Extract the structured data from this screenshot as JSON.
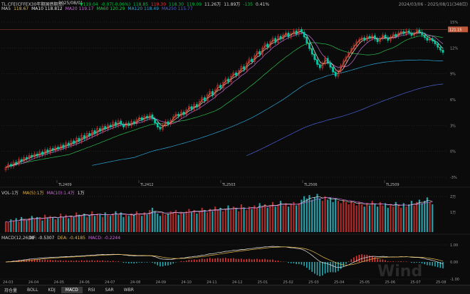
{
  "top_bar": {
    "title": "TL.CFE(CFFEX30年期国债期货)",
    "date": "2025/08/01",
    "items": [
      {
        "text": "▼119.04",
        "color": "#00c040"
      },
      {
        "text": "-0.07(-0.06%)",
        "color": "#00c040"
      },
      {
        "text": "118.85",
        "color": "#00c040"
      },
      {
        "text": "119.30",
        "color": "#e83a3a"
      },
      {
        "text": "118.30",
        "color": "#00c040"
      },
      {
        "text": "119.09",
        "color": "#00c040"
      },
      {
        "text": "11.26万",
        "color": "#cfcfcf"
      },
      {
        "text": "11.89万",
        "color": "#cfcfcf"
      },
      {
        "text": "-135",
        "color": "#00c040"
      },
      {
        "text": "0.41%",
        "color": "#cfcfcf"
      }
    ],
    "range": "2024/03/06 - 2025/08/11(348日)"
  },
  "ma_bar": {
    "items": [
      {
        "label": "MA5",
        "value": "",
        "color": "#cfcfcf"
      },
      {
        "label": "118.67",
        "value": "",
        "color": "#e8b84a"
      },
      {
        "label": "MA10",
        "value": "118.812",
        "color": "#e9e9e9"
      },
      {
        "label": "MA20",
        "value": "119.17",
        "color": "#c96ad8"
      },
      {
        "label": "MA60",
        "value": "120.29",
        "color": "#2bbf4d"
      },
      {
        "label": "MA120",
        "value": "118.49",
        "color": "#2aa6d6"
      },
      {
        "label": "MA250",
        "value": "115.77",
        "color": "#4a63d8"
      }
    ]
  },
  "chart_data": [
    {
      "type": "candlestick",
      "name": "main",
      "y_pct_ticks": [
        "15%",
        "12%",
        "9%",
        "6%",
        "3%",
        "0%",
        "-3%"
      ],
      "price_tag": "121.15",
      "x_labels": [
        "TL2409",
        "TL2412",
        "TL2503",
        "TL2506",
        "TL2509"
      ],
      "ma_colors": {
        "ma5": "#e8b84a",
        "ma10": "#e9e9e9",
        "ma20": "#c96ad8",
        "ma60": "#2bbf4d",
        "ma120": "#2aa6d6",
        "ma250": "#4a63d8"
      },
      "close": [
        102.3,
        102.8,
        102.5,
        103.1,
        102.9,
        103.5,
        103.2,
        103.8,
        103.6,
        104.1,
        103.9,
        104.3,
        104.0,
        104.6,
        104.2,
        104.9,
        104.5,
        105.1,
        104.8,
        105.3,
        105.0,
        105.6,
        105.2,
        105.9,
        105.5,
        106.2,
        105.8,
        106.6,
        106.1,
        107.0,
        106.5,
        107.3,
        106.9,
        107.7,
        107.2,
        108.0,
        107.6,
        108.3,
        107.9,
        108.5,
        108.2,
        108.9,
        108.4,
        109.1,
        108.6,
        108.2,
        108.8,
        108.4,
        109.0,
        108.7,
        109.3,
        109.6,
        109.2,
        109.8,
        109.5,
        110.0,
        109.4,
        108.8,
        108.2,
        107.9,
        108.5,
        109.0,
        108.6,
        109.2,
        109.7,
        110.1,
        109.8,
        110.4,
        110.0,
        110.7,
        111.2,
        110.8,
        111.5,
        111.1,
        111.9,
        112.5,
        112.0,
        112.9,
        113.4,
        112.8,
        113.6,
        114.3,
        113.9,
        114.7,
        115.2,
        114.8,
        115.6,
        116.1,
        115.7,
        116.4,
        117.0,
        116.6,
        117.5,
        118.1,
        117.7,
        118.6,
        119.2,
        118.8,
        119.7,
        120.3,
        119.8,
        120.6,
        121.1,
        120.5,
        121.4,
        121.0,
        121.6,
        121.9,
        121.3,
        121.8,
        122.2,
        121.7,
        122.4,
        122.0,
        121.3,
        120.4,
        119.6,
        118.8,
        118.0,
        117.3,
        116.8,
        117.5,
        118.2,
        117.6,
        116.9,
        116.2,
        115.6,
        116.4,
        117.1,
        117.8,
        118.4,
        119.0,
        119.6,
        120.1,
        120.6,
        120.9,
        121.2,
        120.8,
        121.4,
        121.1,
        121.5,
        121.0,
        120.6,
        121.1,
        121.6,
        121.2,
        120.8,
        121.3,
        121.7,
        121.4,
        121.9,
        122.1,
        121.8,
        122.2,
        121.9,
        121.5,
        121.8,
        122.3,
        122.0,
        121.6,
        121.2,
        120.8,
        121.1,
        120.7,
        120.3,
        119.8,
        119.4,
        119.04
      ],
      "volume_unit": "VOL",
      "volume": [
        9,
        8,
        11,
        10,
        12,
        9,
        13,
        11,
        10,
        12,
        14,
        11,
        13,
        12,
        10,
        15,
        12,
        14,
        13,
        11,
        12,
        16,
        13,
        15,
        12,
        14,
        13,
        17,
        15,
        14,
        16,
        13,
        15,
        18,
        14,
        16,
        15,
        13,
        17,
        15,
        14,
        16,
        18,
        15,
        17,
        13,
        15,
        14,
        16,
        15,
        18,
        16,
        14,
        17,
        15,
        19,
        21,
        18,
        16,
        14,
        17,
        15,
        16,
        18,
        17,
        19,
        15,
        17,
        16,
        18,
        20,
        17,
        19,
        16,
        18,
        21,
        19,
        17,
        20,
        18,
        22,
        19,
        21,
        18,
        20,
        23,
        19,
        22,
        20,
        18,
        24,
        21,
        19,
        22,
        20,
        23,
        21,
        25,
        22,
        24,
        21,
        23,
        26,
        22,
        24,
        27,
        23,
        25,
        22,
        24,
        26,
        23,
        25,
        28,
        31,
        29,
        32,
        28,
        30,
        33,
        29,
        27,
        31,
        28,
        30,
        26,
        29,
        27,
        25,
        28,
        26,
        24,
        27,
        25,
        23,
        26,
        24,
        22,
        25,
        23,
        27,
        24,
        22,
        26,
        23,
        25,
        21,
        24,
        22,
        26,
        23,
        21,
        25,
        22,
        24,
        27,
        23,
        26,
        28,
        25,
        27,
        30,
        26,
        24
      ]
    },
    {
      "type": "volume",
      "name": "vol",
      "label": "VOL-1万",
      "ma_labels": [
        {
          "text": "MA(5):1万",
          "color": "#e8b84a"
        },
        {
          "text": "MA(10):1.4万",
          "color": "#c96ad8"
        },
        {
          "text": "1万",
          "color": "#e9e9e9"
        }
      ],
      "y_labels": [
        "2万",
        "1万"
      ]
    },
    {
      "type": "macd",
      "name": "macd",
      "label": "MACD(12,26,9)",
      "values_text": [
        {
          "text": "DIF: -0.5307",
          "color": "#e9e9e9"
        },
        {
          "text": "DEA: -0.4185",
          "color": "#e8b84a"
        },
        {
          "text": "MACD: -0.2244",
          "color": "#c96ad8"
        }
      ],
      "y_labels": [
        "1.00",
        "0.00",
        "-1.00"
      ],
      "x_labels": [
        "24-03",
        "24-04",
        "24-05",
        "24-06",
        "24-07",
        "24-08",
        "24-09",
        "24-10",
        "24-11",
        "24-12",
        "25-01",
        "25-02",
        "25-03",
        "25-04",
        "25-05",
        "25-06",
        "25-07",
        "25-08"
      ],
      "watermark": "Wind"
    }
  ],
  "tabs": [
    "持仓量",
    "BOLL",
    "KDJ",
    "MACD",
    "RSI",
    "SAR",
    "WBR"
  ],
  "active_tab": "MACD"
}
